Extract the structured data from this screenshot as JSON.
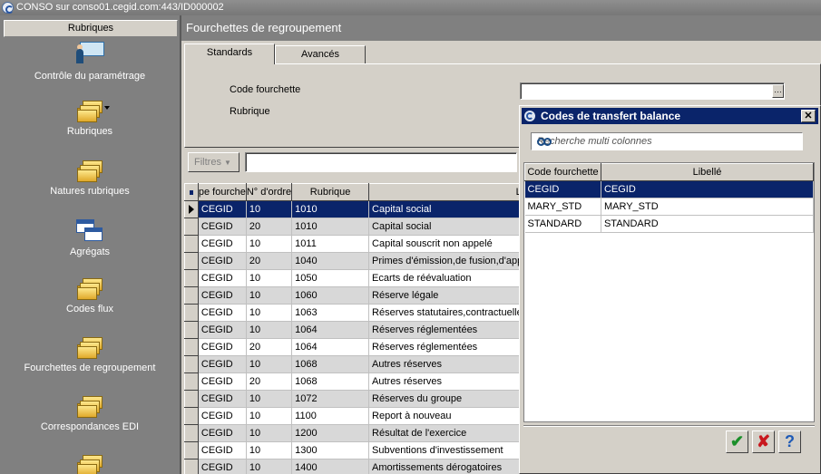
{
  "window": {
    "title": "CONSO sur conso01.cegid.com:443/ID000002"
  },
  "sidebar": {
    "header": "Rubriques",
    "items": [
      {
        "label": "Contrôle du paramétrage",
        "icon": "presenter-icon"
      },
      {
        "label": "Rubriques",
        "icon": "folder-icon"
      },
      {
        "label": "Natures rubriques",
        "icon": "folder-icon"
      },
      {
        "label": "Agrégats",
        "icon": "aggregate-icon"
      },
      {
        "label": "Codes flux",
        "icon": "folder-icon"
      },
      {
        "label": "Fourchettes de regroupement",
        "icon": "folder-icon"
      },
      {
        "label": "Correspondances EDI",
        "icon": "folder-icon"
      }
    ]
  },
  "main": {
    "title": "Fourchettes de regroupement",
    "tabs": [
      {
        "label": "Standards"
      },
      {
        "label": "Avancés"
      }
    ],
    "fields": {
      "code_label": "Code fourchette",
      "code_value": "",
      "rubrique_label": "Rubrique"
    },
    "filter_button": "Filtres",
    "grid": {
      "columns": [
        "pe fourche",
        "N° d'ordre",
        "Rubrique",
        "Libellé"
      ],
      "rows": [
        [
          "CEGID",
          "10",
          "1010",
          "Capital social"
        ],
        [
          "CEGID",
          "20",
          "1010",
          "Capital social"
        ],
        [
          "CEGID",
          "10",
          "1011",
          "Capital souscrit non appelé"
        ],
        [
          "CEGID",
          "20",
          "1040",
          "Primes d'émission,de fusion,d'apport"
        ],
        [
          "CEGID",
          "10",
          "1050",
          "Ecarts de réévaluation"
        ],
        [
          "CEGID",
          "10",
          "1060",
          "Réserve légale"
        ],
        [
          "CEGID",
          "10",
          "1063",
          "Réserves statutaires,contractuelles"
        ],
        [
          "CEGID",
          "10",
          "1064",
          "Réserves réglementées"
        ],
        [
          "CEGID",
          "20",
          "1064",
          "Réserves réglementées"
        ],
        [
          "CEGID",
          "10",
          "1068",
          "Autres réserves"
        ],
        [
          "CEGID",
          "20",
          "1068",
          "Autres réserves"
        ],
        [
          "CEGID",
          "10",
          "1072",
          "Réserves du groupe"
        ],
        [
          "CEGID",
          "10",
          "1100",
          "Report à nouveau"
        ],
        [
          "CEGID",
          "10",
          "1200",
          "Résultat de l'exercice"
        ],
        [
          "CEGID",
          "10",
          "1300",
          "Subventions d'investissement"
        ],
        [
          "CEGID",
          "10",
          "1400",
          "Amortissements dérogatoires"
        ]
      ],
      "selected_row": 0
    }
  },
  "dialog": {
    "title": "Codes de transfert balance",
    "search_placeholder": "Recherche multi colonnes",
    "columns": [
      "Code fourchette",
      "Libellé"
    ],
    "rows": [
      [
        "CEGID",
        "CEGID"
      ],
      [
        "MARY_STD",
        "MARY_STD"
      ],
      [
        "STANDARD",
        "STANDARD"
      ]
    ],
    "selected_row": 0,
    "buttons": {
      "ok": "✔",
      "cancel": "✘",
      "help": "?"
    }
  },
  "colors": {
    "selection": "#0a246a",
    "panel_grey": "#808080",
    "face": "#d4d0c8"
  }
}
